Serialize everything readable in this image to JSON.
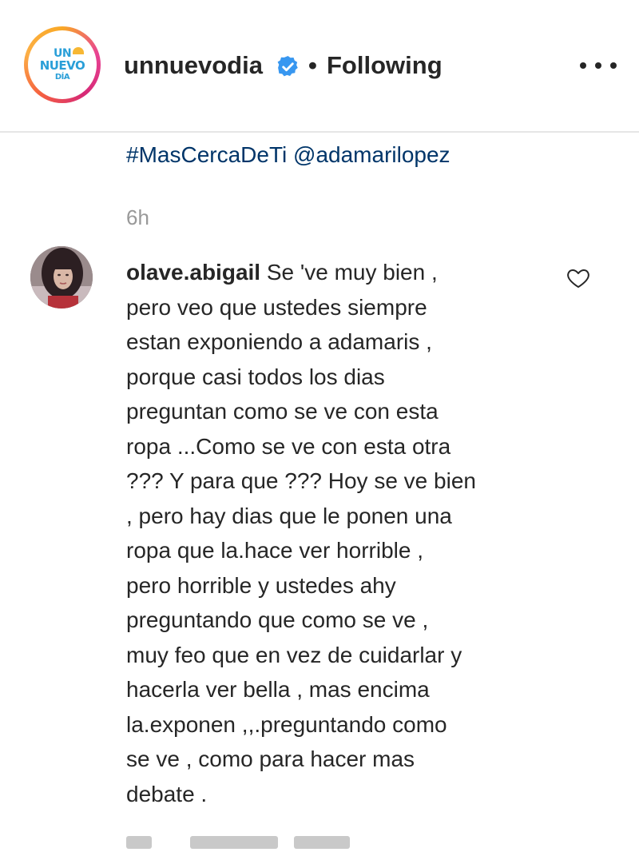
{
  "post": {
    "account": {
      "username": "unnuevodia",
      "verified": true,
      "logo_text": [
        "UN",
        "NUEVO",
        "DÍA"
      ],
      "follow_separator": "•",
      "follow_status": "Following",
      "more_icon": "more-horizontal-icon"
    },
    "caption_tail": {
      "hashtag": "#MasCercaDeTi",
      "mention": "@adamarilopez"
    },
    "timestamp": "6h"
  },
  "comment": {
    "author": "olave.abigail",
    "lines": [
      "Se 've muy bien ,",
      "pero veo que ustedes siempre",
      "estan exponiendo a adamaris ,",
      "porque casi todos los dias",
      "preguntan como se ve con esta",
      "ropa ...Como se ve con esta otra",
      "??? Y para que ??? Hoy se ve bien",
      ", pero hay dias que le ponen una",
      "ropa que la.hace ver horrible ,",
      "pero horrible y ustedes ahy",
      "preguntando que como se ve ,",
      "muy feo que en vez de cuidarlar y",
      "hacerla ver bella , mas encima",
      "la.exponen ,,.preguntando como",
      "se ve , como para hacer mas",
      "debate ."
    ],
    "like_icon": "heart-outline-icon"
  },
  "colors": {
    "link": "#003569",
    "muted": "#999999",
    "text": "#262626",
    "verified_blue": "#3897f0",
    "divider": "#e6e6e6",
    "logo_blue": "#2a9fd8"
  }
}
